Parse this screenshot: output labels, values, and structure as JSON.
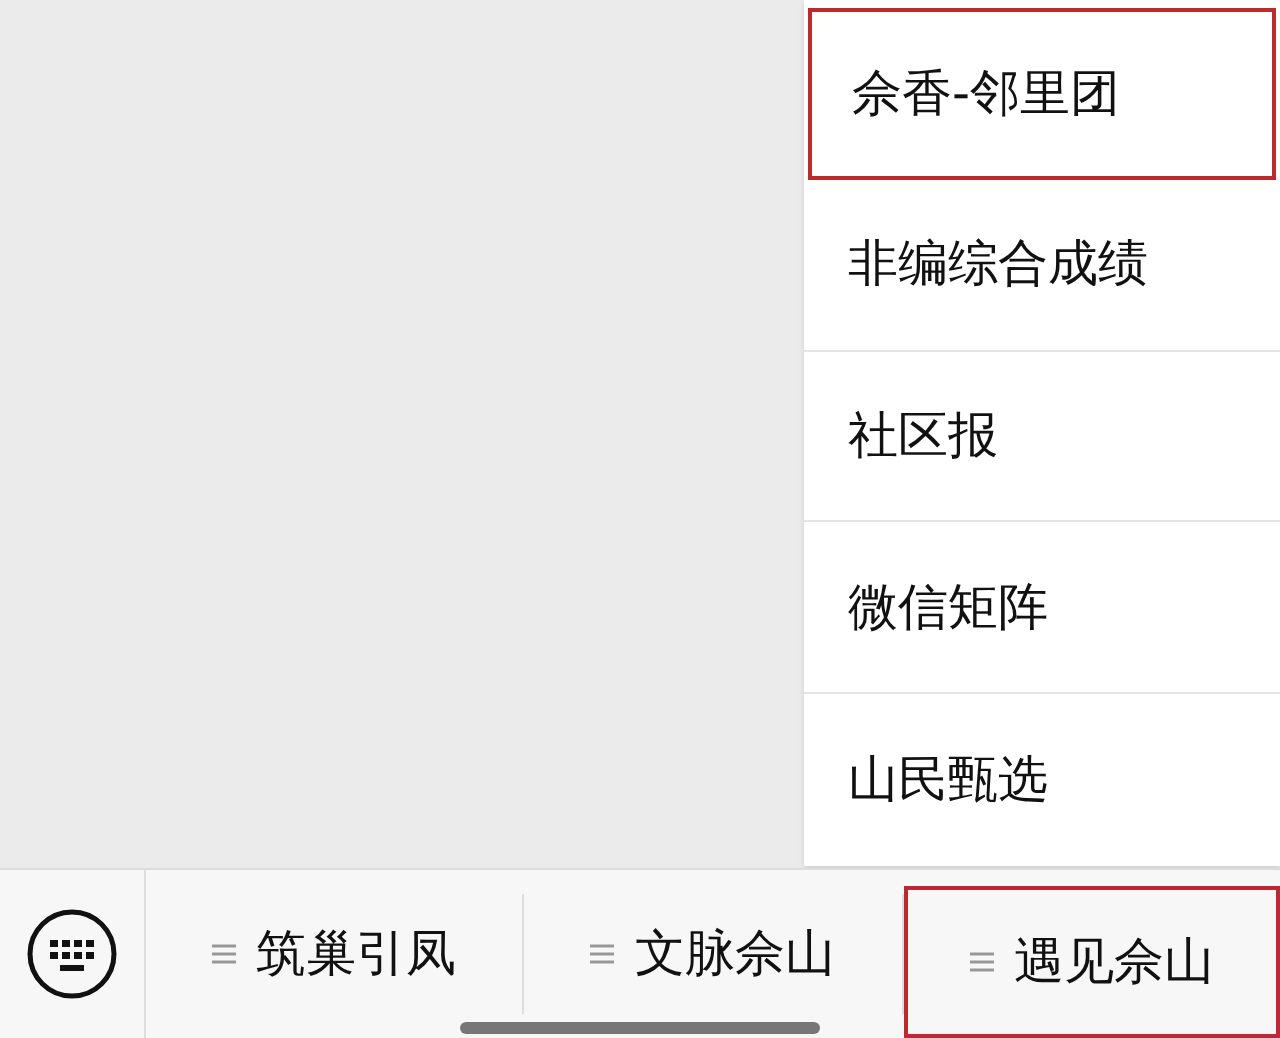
{
  "menu_popup": {
    "items": [
      {
        "label": "佘香-邻里团",
        "selected": true
      },
      {
        "label": "非编综合成绩",
        "selected": false
      },
      {
        "label": "社区报",
        "selected": false
      },
      {
        "label": "微信矩阵",
        "selected": false
      },
      {
        "label": "山民甄选",
        "selected": false
      }
    ]
  },
  "bottom_menu": {
    "tabs": [
      {
        "label": "筑巢引凤",
        "selected": false
      },
      {
        "label": "文脉佘山",
        "selected": false
      },
      {
        "label": "遇见佘山",
        "selected": true
      }
    ]
  }
}
